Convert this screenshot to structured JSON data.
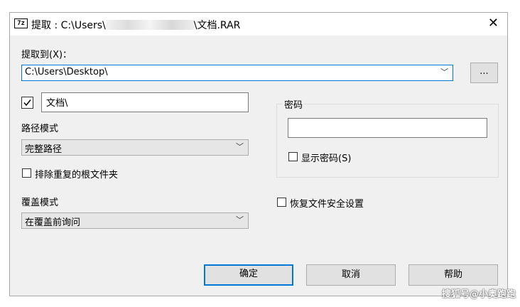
{
  "window": {
    "title_prefix": "提取 : C:\\Users\\",
    "title_suffix": "\\文档.RAR",
    "icon_text": "7z",
    "close_glyph": "✕"
  },
  "extract_to": {
    "label": "提取到(X)：",
    "path_value": "C:\\Users\\Desktop\\",
    "browse_label": "..."
  },
  "subfolder": {
    "checked": true,
    "name_value": "文档\\"
  },
  "path_mode": {
    "label": "路径模式",
    "selected": "完整路径"
  },
  "exclude_duplicate_root": {
    "label": "排除重复的根文件夹",
    "checked": false
  },
  "overwrite_mode": {
    "label": "覆盖模式",
    "selected": "在覆盖前询问"
  },
  "password": {
    "group_label": "密码",
    "value": "",
    "show_label": "显示密码(S)",
    "show_checked": false
  },
  "restore_security": {
    "label": "恢复文件安全设置",
    "checked": false
  },
  "buttons": {
    "ok": "确定",
    "cancel": "取消",
    "help": "帮助"
  },
  "chevron_glyph": "﹀",
  "watermark": "搜狐号@小奥跑跑",
  "colors": {
    "accent": "#0078d7",
    "dialog_bg": "#f0f0f0",
    "button_bg": "#e1e1e1"
  }
}
